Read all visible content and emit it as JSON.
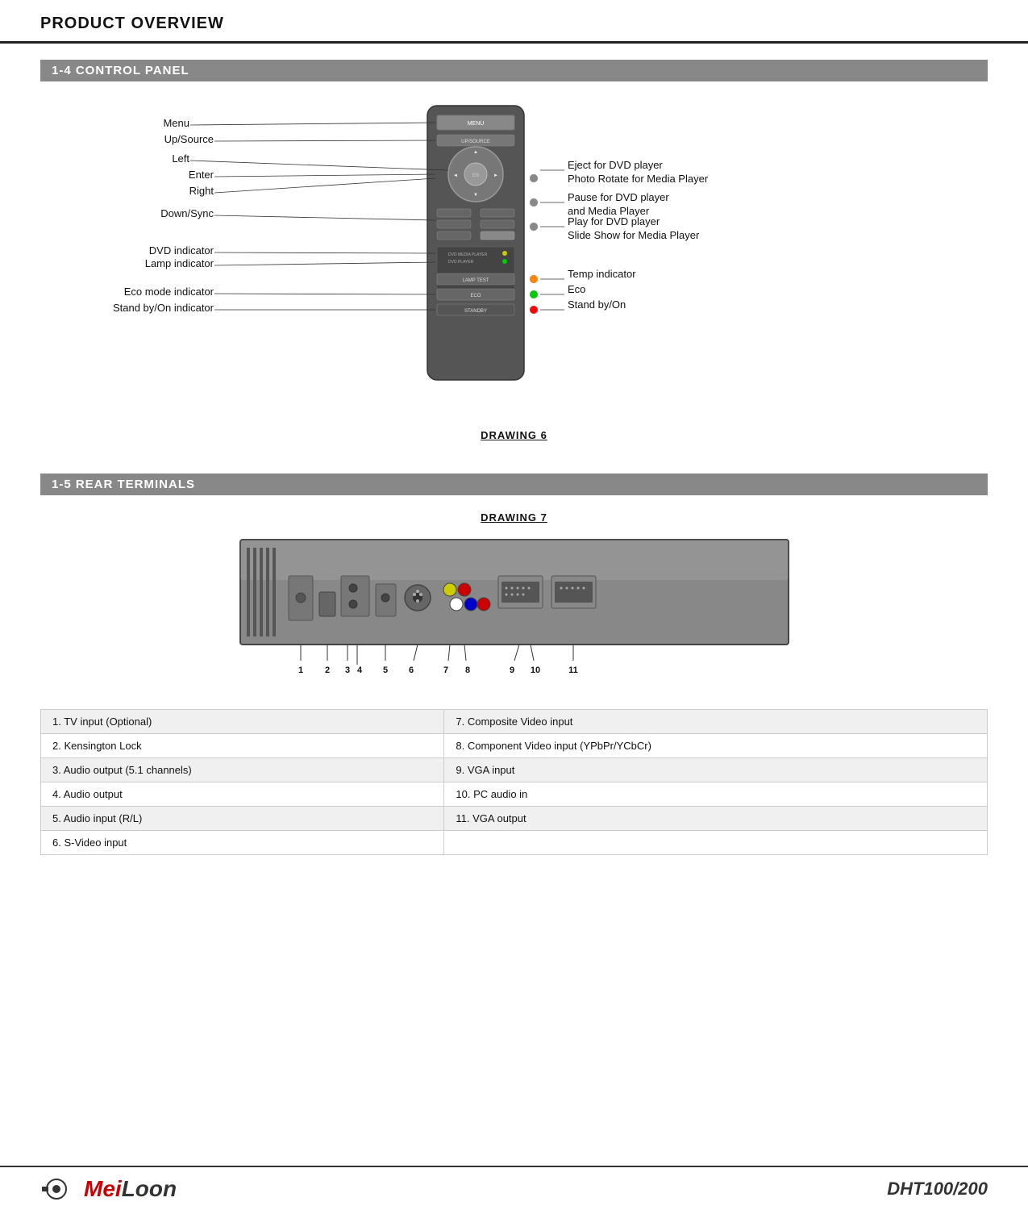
{
  "page": {
    "title": "PRODUCT OVERVIEW"
  },
  "sections": {
    "control_panel": {
      "header": "1-4   CONTROL PANEL",
      "drawing_caption": "DRAWING 6",
      "labels_left": [
        "Menu",
        "Up/Source",
        "Left",
        "Enter",
        "Right",
        "Down/Sync",
        "DVD indicator",
        "Lamp indicator",
        "Eco mode indicator",
        "Stand by/On indicator"
      ],
      "labels_right_group1": [
        "Eject for DVD player",
        "Photo Rotate for Media Player"
      ],
      "labels_right_group2": [
        "Pause for DVD player",
        "and Media Player"
      ],
      "labels_right_group3": [
        "Play for DVD player",
        "Slide Show for Media Player"
      ],
      "labels_right_group4": [
        "Temp indicator",
        "Eco",
        "Stand by/On"
      ]
    },
    "rear_terminals": {
      "header": "1-5   REAR TERMINALS",
      "drawing_caption": "DRAWING 7",
      "numbers": [
        "1",
        "2",
        "3",
        "4",
        "5",
        "6",
        "7",
        "8",
        "9",
        "10",
        "11"
      ],
      "table_rows": [
        {
          "left": "1. TV input (Optional)",
          "right": "7. Composite Video input"
        },
        {
          "left": "2. Kensington Lock",
          "right": "8. Component Video input (YPbPr/YCbCr)"
        },
        {
          "left": "3. Audio output (5.1 channels)",
          "right": "9. VGA input"
        },
        {
          "left": "4. Audio output",
          "right": "10. PC audio in"
        },
        {
          "left": "5. Audio input (R/L)",
          "right": "11. VGA output"
        },
        {
          "left": "6. S-Video input",
          "right": ""
        }
      ]
    }
  },
  "footer": {
    "brand": "MeiLoon",
    "model": "DHT100/200",
    "connector_symbol": "⊣○"
  }
}
